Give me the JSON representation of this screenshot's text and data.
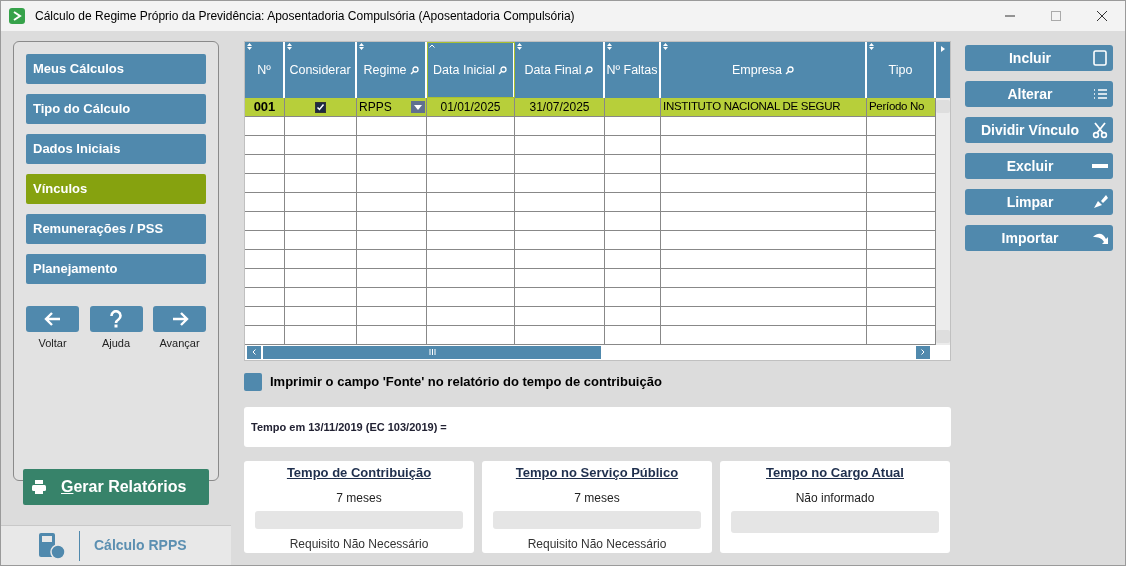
{
  "window": {
    "title": "Cálculo de Regime Próprio da Previdência: Aposentadoria Compulsória (Aposentadoria Compulsória)"
  },
  "sidebar": {
    "items": [
      {
        "label": "Meus Cálculos",
        "selected": false
      },
      {
        "label": "Tipo do Cálculo",
        "selected": false
      },
      {
        "label": "Dados Iniciais",
        "selected": false
      },
      {
        "label": "Vínculos",
        "selected": true
      },
      {
        "label": "Remunerações / PSS",
        "selected": false
      },
      {
        "label": "Planejamento",
        "selected": false
      }
    ],
    "nav": [
      {
        "kind": "back",
        "label": "Voltar"
      },
      {
        "kind": "help",
        "label": "Ajuda"
      },
      {
        "kind": "next",
        "label": "Avançar"
      }
    ],
    "report_button": {
      "mnemonic": "G",
      "label": "erar Relatórios"
    },
    "footer": "Cálculo RPPS"
  },
  "table": {
    "columns": [
      {
        "label": "Nº",
        "search": false,
        "sorted": false
      },
      {
        "label": "Considerar",
        "search": false,
        "sorted": false
      },
      {
        "label": "Regime",
        "search": true,
        "sorted": false
      },
      {
        "label": "Data Inicial",
        "search": true,
        "sorted": true
      },
      {
        "label": "Data Final",
        "search": true,
        "sorted": false
      },
      {
        "label": "Nº Faltas",
        "search": false,
        "sorted": false
      },
      {
        "label": "Empresa",
        "search": true,
        "sorted": false
      },
      {
        "label": "Tipo",
        "search": false,
        "sorted": false
      }
    ],
    "rows": [
      {
        "selected": true,
        "cells": [
          {
            "kind": "text",
            "text": "001"
          },
          {
            "kind": "check",
            "checked": true
          },
          {
            "kind": "select",
            "text": "RPPS"
          },
          {
            "kind": "text",
            "text": "01/01/2025"
          },
          {
            "kind": "text",
            "text": "31/07/2025"
          },
          {
            "kind": "empty"
          },
          {
            "kind": "text",
            "text": "INSTITUTO NACIONAL DE SEGUR"
          },
          {
            "kind": "text",
            "text": "Período No"
          }
        ]
      }
    ]
  },
  "actions": [
    {
      "kind": "square",
      "label": "Incluir"
    },
    {
      "kind": "list",
      "label": "Alterar"
    },
    {
      "kind": "scissors",
      "label": "Dividir Vínculo"
    },
    {
      "kind": "minus",
      "label": "Excluir"
    },
    {
      "kind": "brush",
      "label": "Limpar"
    },
    {
      "kind": "turn",
      "label": "Importar"
    }
  ],
  "print_source": {
    "label": "Imprimir o campo 'Fonte' no relatório do tempo de contribuição",
    "checked": false
  },
  "tempo_ec": "Tempo em 13/11/2019 (EC 103/2019) =",
  "summary": [
    {
      "title": "Tempo de Contribuição",
      "value": "7 meses",
      "note": "Requisito Não Necessário"
    },
    {
      "title": "Tempo no Serviço Público",
      "value": "7 meses",
      "note": "Requisito Não Necessário"
    },
    {
      "title": "Tempo no Cargo Atual",
      "value": "Não informado"
    }
  ]
}
